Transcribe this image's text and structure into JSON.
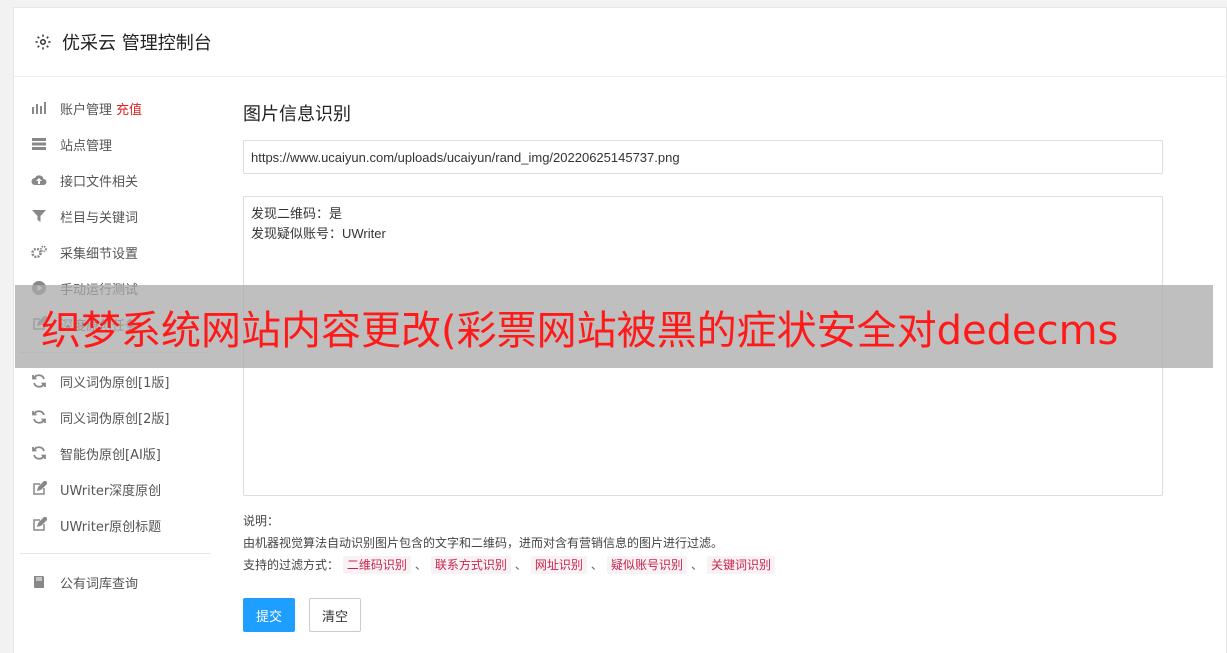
{
  "header": {
    "title": "优采云 管理控制台",
    "icon": "gear-icon"
  },
  "sidebar": {
    "groups": [
      [
        {
          "icon": "bar-chart-icon",
          "label": "账户管理",
          "badge": "充值"
        },
        {
          "icon": "server-icon",
          "label": "站点管理"
        },
        {
          "icon": "cloud-upload-icon",
          "label": "接口文件相关"
        },
        {
          "icon": "filter-icon",
          "label": "栏目与关键词"
        },
        {
          "icon": "cogs-icon",
          "label": "采集细节设置"
        },
        {
          "icon": "play-circle-icon",
          "label": "手动运行测试"
        },
        {
          "icon": "edit-icon",
          "label": "深度原创任务"
        }
      ],
      [
        {
          "icon": "refresh-icon",
          "label": "同义词伪原创[1版]"
        },
        {
          "icon": "refresh-icon",
          "label": "同义词伪原创[2版]"
        },
        {
          "icon": "refresh-icon",
          "label": "智能伪原创[AI版]"
        },
        {
          "icon": "edit-icon",
          "label": "UWriter深度原创"
        },
        {
          "icon": "edit-icon",
          "label": "UWriter原创标题"
        }
      ],
      [
        {
          "icon": "book-icon",
          "label": "公有词库查询"
        }
      ]
    ]
  },
  "main": {
    "title": "图片信息识别",
    "url_value": "https://www.ucaiyun.com/uploads/ucaiyun/rand_img/20220625145737.png",
    "result_lines": [
      "发现二维码：是",
      "发现疑似账号：UWriter"
    ],
    "desc_label": "说明：",
    "desc_text": "由机器视觉算法自动识别图片包含的文字和二维码，进而对含有营销信息的图片进行过滤。",
    "filter_label": "支持的过滤方式：",
    "filters": [
      "二维码识别",
      "联系方式识别",
      "网址识别",
      "疑似账号识别",
      "关键词识别"
    ],
    "filter_sep": "、",
    "submit_label": "提交",
    "clear_label": "清空"
  },
  "banner": {
    "text": "织梦系统网站内容更改(彩票网站被黑的症状安全对dedecms",
    "color": "#ff1a1a"
  }
}
